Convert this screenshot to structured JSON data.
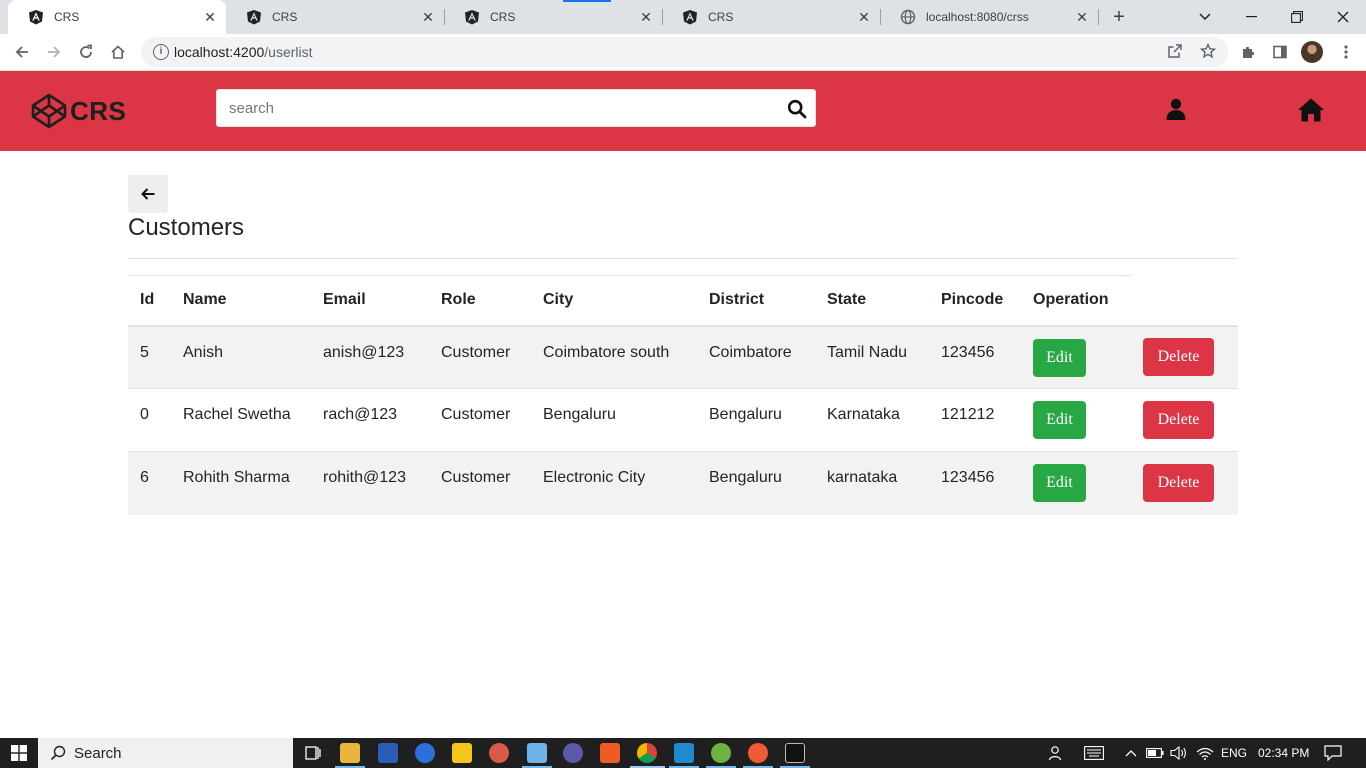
{
  "browser": {
    "tabs": [
      {
        "title": "CRS",
        "active": true
      },
      {
        "title": "CRS",
        "active": false
      },
      {
        "title": "CRS",
        "active": false
      },
      {
        "title": "CRS",
        "active": false
      },
      {
        "title": "localhost:8080/crss",
        "active": false
      }
    ],
    "url_host": "localhost:4200",
    "url_path": "/userlist"
  },
  "header": {
    "brand": "CRS",
    "search_placeholder": "search"
  },
  "page": {
    "title": "Customers"
  },
  "table": {
    "columns": [
      "Id",
      "Name",
      "Email",
      "Role",
      "City",
      "District",
      "State",
      "Pincode",
      "Operation"
    ],
    "rows": [
      {
        "id": "5",
        "name": "Anish",
        "email": "anish@123",
        "role": "Customer",
        "city": "Coimbatore south",
        "district": "Coimbatore",
        "state": "Tamil Nadu",
        "pincode": "123456"
      },
      {
        "id": "0",
        "name": "Rachel Swetha",
        "email": "rach@123",
        "role": "Customer",
        "city": "Bengaluru",
        "district": "Bengaluru",
        "state": "Karnataka",
        "pincode": "121212"
      },
      {
        "id": "6",
        "name": "Rohith Sharma",
        "email": "rohith@123",
        "role": "Customer",
        "city": "Electronic City",
        "district": "Bengaluru",
        "state": "karnataka",
        "pincode": "123456"
      }
    ],
    "edit_label": "Edit",
    "delete_label": "Delete"
  },
  "taskbar": {
    "search_label": "Search",
    "language": "ENG",
    "time": "02:34 PM"
  },
  "colors": {
    "header": "#dc3545",
    "edit": "#28a745",
    "delete": "#dc3545"
  }
}
